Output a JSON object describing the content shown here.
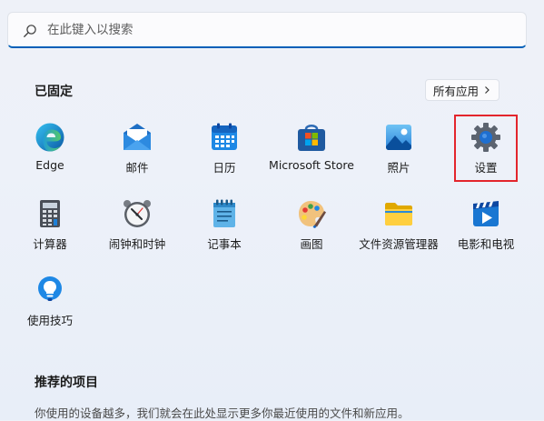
{
  "search": {
    "placeholder": "在此键入以搜索"
  },
  "pinned": {
    "title": "已固定",
    "all_apps_label": "所有应用",
    "apps": [
      {
        "label": "Edge",
        "icon": "edge-icon"
      },
      {
        "label": "邮件",
        "icon": "mail-icon"
      },
      {
        "label": "日历",
        "icon": "calendar-icon"
      },
      {
        "label": "Microsoft Store",
        "icon": "store-icon"
      },
      {
        "label": "照片",
        "icon": "photos-icon"
      },
      {
        "label": "设置",
        "icon": "gear-icon"
      },
      {
        "label": "计算器",
        "icon": "calculator-icon"
      },
      {
        "label": "闹钟和时钟",
        "icon": "clock-icon"
      },
      {
        "label": "记事本",
        "icon": "notepad-icon"
      },
      {
        "label": "画图",
        "icon": "paint-icon"
      },
      {
        "label": "文件资源管理器",
        "icon": "folder-icon"
      },
      {
        "label": "电影和电视",
        "icon": "movies-icon"
      },
      {
        "label": "使用技巧",
        "icon": "tips-icon"
      }
    ]
  },
  "recommended": {
    "title": "推荐的项目",
    "text": "你使用的设备越多，我们就会在此处显示更多你最近使用的文件和新应用。"
  },
  "colors": {
    "accent": "#005fb8",
    "highlight_border": "#e3252c"
  }
}
